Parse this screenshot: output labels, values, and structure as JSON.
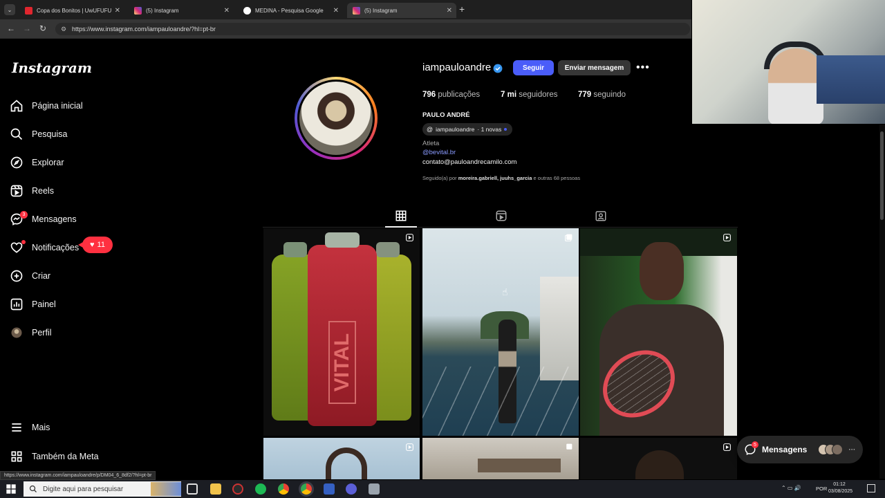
{
  "browser": {
    "tabs": [
      {
        "title": "Copa dos Bonitos | UwUFUFU",
        "icon": "uwufufu-icon",
        "color": "#e0262e"
      },
      {
        "title": "(5) Instagram",
        "icon": "instagram-icon",
        "color": "#d62976"
      },
      {
        "title": "MEDINA - Pesquisa Google",
        "icon": "google-icon",
        "color": "#4285f4"
      },
      {
        "title": "(5) Instagram",
        "icon": "instagram-icon",
        "color": "#d62976",
        "active": true
      }
    ],
    "url": "https://www.instagram.com/iampauloandre/?hl=pt-br",
    "status_url": "https://www.instagram.com/iampauloandre/p/DM04_6_8df2/?hl=pt-br"
  },
  "sidebar": {
    "logo": "Instagram",
    "items": [
      {
        "label": "Página inicial",
        "icon": "home-icon"
      },
      {
        "label": "Pesquisa",
        "icon": "search-icon"
      },
      {
        "label": "Explorar",
        "icon": "compass-icon"
      },
      {
        "label": "Reels",
        "icon": "reels-icon"
      },
      {
        "label": "Mensagens",
        "icon": "messenger-icon",
        "badge": "3"
      },
      {
        "label": "Notificações",
        "icon": "heart-icon"
      },
      {
        "label": "Criar",
        "icon": "plus-icon"
      },
      {
        "label": "Painel",
        "icon": "chart-icon"
      },
      {
        "label": "Perfil",
        "icon": "avatar-icon"
      }
    ],
    "bottom_items": [
      {
        "label": "Mais",
        "icon": "menu-icon"
      },
      {
        "label": "Também da Meta",
        "icon": "grid-icon"
      }
    ],
    "notification_count": "11"
  },
  "profile": {
    "username": "iampauloandre",
    "follow_label": "Seguir",
    "message_label": "Enviar mensagem",
    "posts_count": "796",
    "posts_label": "publicações",
    "followers_count": "7 mi",
    "followers_label": "seguidores",
    "following_count": "779",
    "following_label": "seguindo",
    "full_name": "PAULO ANDRÉ",
    "threads_handle": "iampauloandre",
    "threads_new": "· 1 novas",
    "category": "Atleta",
    "link": "@bevital.br",
    "email": "contato@pauloandrecamilo.com",
    "followed_by_prefix": "Seguido(a) por",
    "followed_by_names": "moreira.gabriell, juuhs_garcia",
    "followed_by_suffix": "e outras 68 pessoas"
  },
  "posts": [
    {
      "alt": "VITAL bottles",
      "multi": true
    },
    {
      "alt": "running track",
      "multi": true
    },
    {
      "alt": "tennis racket portrait",
      "multi": true
    },
    {
      "alt": "arms raised",
      "multi": true
    },
    {
      "alt": "room",
      "multi": true
    },
    {
      "alt": "portrait",
      "multi": true
    }
  ],
  "vital_text": "VITAL",
  "messages_float": {
    "label": "Mensagens",
    "badge": "5"
  },
  "taskbar": {
    "search_placeholder": "Digite aqui para pesquisar",
    "lang": "POR",
    "time": "01:12",
    "date": "03/08/2025"
  }
}
